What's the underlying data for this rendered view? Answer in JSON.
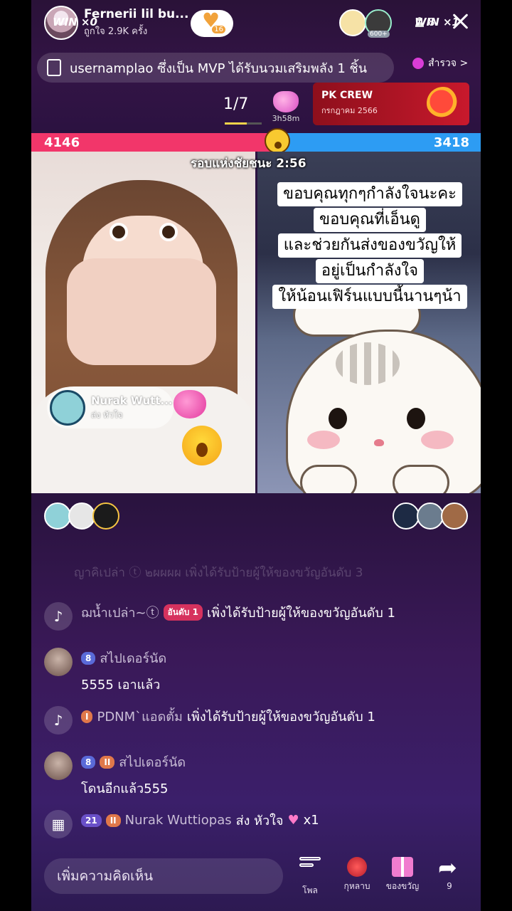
{
  "header": {
    "host_name": "Fernerii lil bu...",
    "host_likes": "ถูกใจ 2.9K ครั้ง",
    "follow_badge": "16",
    "viewer_badge": "600+",
    "viewer_count": "8"
  },
  "banner": {
    "text": "usernamplao ซึ่งเป็น MVP ได้รับนวมเสริมพลัง 1 ชิ้น",
    "explore_label": "สำรวจ >"
  },
  "battle": {
    "rank": "1/7",
    "gift_timer": "3h58m",
    "pk_title": "PK CREW",
    "pk_subtitle": "กรกฎาคม 2566",
    "score_left": "4146",
    "score_right": "3418",
    "round_label": "รอบแห่งชัยชนะ 2:56",
    "win_left": "WIN ×0",
    "win_right": "WIN ×1"
  },
  "gift_popup": {
    "name": "Nurak Wutt...",
    "action": "ส่ง หัวใจ"
  },
  "caption": {
    "lines": [
      "ขอบคุณทุกๆกำลังใจนะคะ",
      "ขอบคุณที่เอ็นดู",
      "และช่วยกันส่งของขวัญให้",
      "อยู่เป็นกำลังใจ",
      "ให้น้อนเฟิร์นแบบนี้นานๆน้า"
    ]
  },
  "chat": {
    "faded_text": "ญาคิเปล่า ⓣ ๒ผผผผ เพิ่งได้รับป้ายผู้ให้ของขวัญอันดับ 3",
    "messages": [
      {
        "user": "ฌน้ำเปล่า~ⓣ",
        "badge": "อันดับ 1",
        "text": "เพิ่งได้รับป้ายผู้ให้ของขวัญอันดับ 1"
      },
      {
        "level": "8",
        "user": "สไปเดอร์นัด",
        "text": "5555 เอาแล้ว"
      },
      {
        "badge": "I",
        "user": "PDNM`แอดตั้ม",
        "text": "เพิ่งได้รับป้ายผู้ให้ของขวัญอันดับ 1"
      },
      {
        "level": "8",
        "badge": "II",
        "user": "สไปเดอร์นัด",
        "text": "โดนอีกแล้ว555"
      },
      {
        "level": "21",
        "badge": "II",
        "user": "Nurak Wuttiopas",
        "action": "ส่ง หัวใจ",
        "count": "x1"
      }
    ]
  },
  "bottom": {
    "comment_placeholder": "เพิ่มความคิดเห็น",
    "more_label": "โพล",
    "rose_label": "กุหลาบ",
    "gift_label": "ของขวัญ",
    "share_count": "9"
  },
  "colors": {
    "score_red": "#f2366a",
    "score_blue": "#2d9cf3",
    "pk_red": "#c8192c"
  },
  "icons": [
    "close-icon",
    "user-icon",
    "flag-icon",
    "explore-icon",
    "tiktok-icon",
    "calendar-icon",
    "poll-icon",
    "rose-icon",
    "gift-icon",
    "share-icon"
  ]
}
